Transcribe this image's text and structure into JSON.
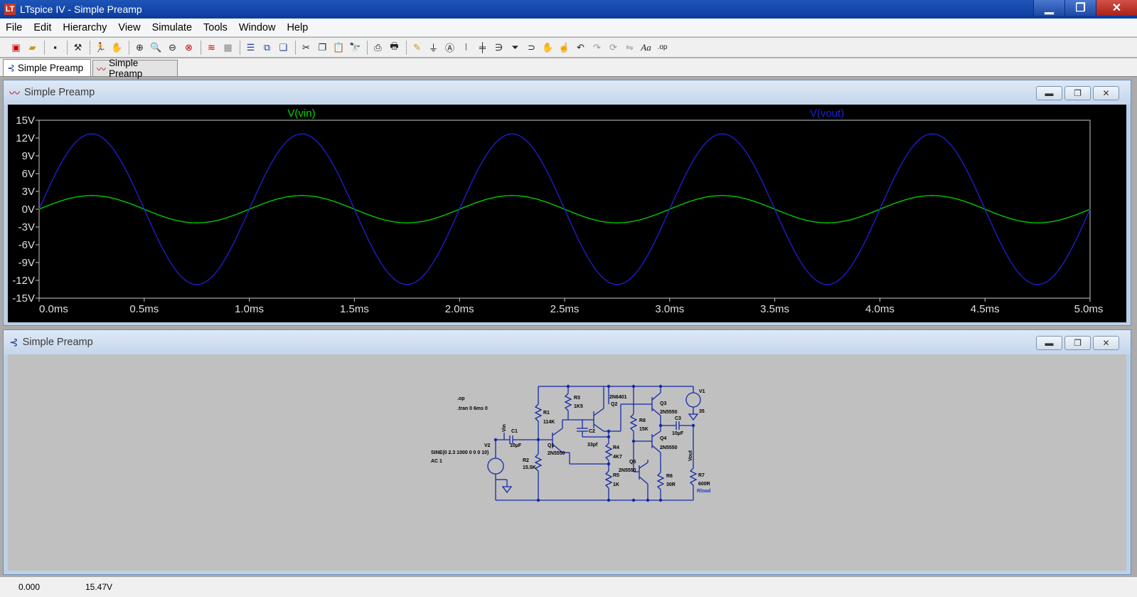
{
  "window": {
    "title": "LTspice IV - Simple Preamp",
    "logo_text": "LT"
  },
  "menu": [
    "File",
    "Edit",
    "Hierarchy",
    "View",
    "Simulate",
    "Tools",
    "Window",
    "Help"
  ],
  "toolbar_icons": [
    "new-schematic",
    "open",
    "save",
    "control-panel",
    "run",
    "halt",
    "zoom-in",
    "pan",
    "zoom-out",
    "zoom-fit",
    "autorange",
    "grid",
    "tile-horizontal",
    "tile-vertical",
    "cascade",
    "cut",
    "copy",
    "paste",
    "find",
    "print-setup",
    "print",
    "draw-wire",
    "ground",
    "label-net",
    "resistor",
    "capacitor",
    "inductor",
    "diode",
    "component",
    "move",
    "drag",
    "undo",
    "redo",
    "rotate",
    "mirror",
    "text",
    "spice-directive"
  ],
  "tabs": [
    {
      "label": "Simple Preamp",
      "icon": "schematic-icon"
    },
    {
      "label": "Simple Preamp",
      "icon": "waveform-icon"
    }
  ],
  "plot_window": {
    "title": "Simple Preamp"
  },
  "schematic_window": {
    "title": "Simple Preamp"
  },
  "chart_data": {
    "type": "line",
    "x_ticks": [
      "0.0ms",
      "0.5ms",
      "1.0ms",
      "1.5ms",
      "2.0ms",
      "2.5ms",
      "3.0ms",
      "3.5ms",
      "4.0ms",
      "4.5ms",
      "5.0ms"
    ],
    "y_ticks": [
      "15V",
      "12V",
      "9V",
      "6V",
      "3V",
      "0V",
      "-3V",
      "-6V",
      "-9V",
      "-12V",
      "-15V"
    ],
    "xlim": [
      0,
      5
    ],
    "ylim": [
      -15,
      15
    ],
    "grid": false,
    "series": [
      {
        "name": "V(vin)",
        "color": "#00d800",
        "amplitude": 2.3,
        "frequency_hz": 1000,
        "phase": "in-phase"
      },
      {
        "name": "V(vout)",
        "color": "#2020d8",
        "amplitude": 12.7,
        "frequency_hz": 1000,
        "phase": "in-phase"
      }
    ]
  },
  "schematic": {
    "directives": [
      ".op",
      ".tran 0 6ms 0"
    ],
    "source_text": [
      "SINE(0 2.3 1000 0 0 0 10)",
      "AC 1"
    ],
    "net_labels": [
      "Vin",
      "Vout"
    ],
    "components": [
      {
        "ref": "V1",
        "value": "35"
      },
      {
        "ref": "V2",
        "value": ""
      },
      {
        "ref": "C1",
        "value": "10µF"
      },
      {
        "ref": "C2",
        "value": "33pf"
      },
      {
        "ref": "C3",
        "value": "10µF"
      },
      {
        "ref": "R1",
        "value": "114K"
      },
      {
        "ref": "R2",
        "value": "15.5K"
      },
      {
        "ref": "R3",
        "value": "1K5"
      },
      {
        "ref": "R4",
        "value": "4K7"
      },
      {
        "ref": "R5",
        "value": "1K"
      },
      {
        "ref": "R6",
        "value": "30R"
      },
      {
        "ref": "R7",
        "value": "600R"
      },
      {
        "ref": "R8",
        "value": "15K"
      },
      {
        "ref": "Q1",
        "value": "2N5550"
      },
      {
        "ref": "Q2",
        "value": "2N6401"
      },
      {
        "ref": "Q3",
        "value": "2N5550"
      },
      {
        "ref": "Q4",
        "value": "2N5550"
      },
      {
        "ref": "Q5",
        "value": "2N5550"
      }
    ],
    "load_label": "Rload"
  },
  "status": {
    "left": "0.000",
    "right": "15.47V"
  }
}
